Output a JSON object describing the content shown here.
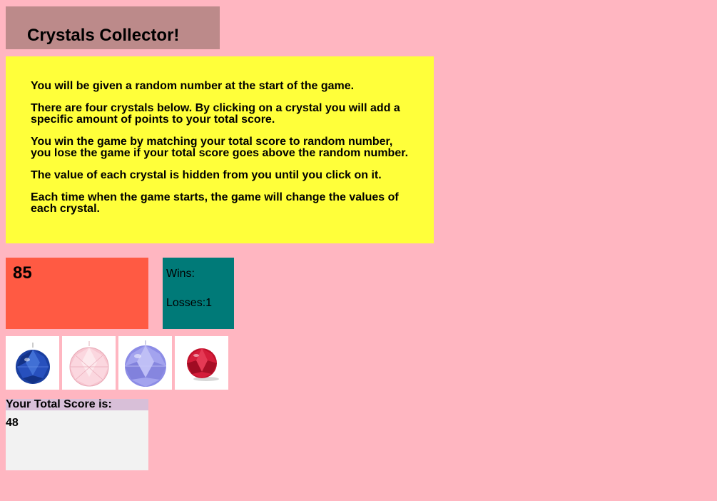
{
  "header": {
    "title": "Crystals Collector!"
  },
  "instructions": [
    "You will be given a random number at the start of the game.",
    "There are four crystals below. By clicking on a crystal you will add a specific amount of points to your total score.",
    "You win the game by matching your total score to random number, you lose the game if your total score goes above the random number.",
    "The value of each crystal is hidden from you until you click on it.",
    "Each time when the game starts, the game will change the values of each crystal."
  ],
  "game": {
    "random_number": "85",
    "wins_label": "Wins:",
    "wins_value": "",
    "losses_label": "Losses:",
    "losses_value": "1",
    "score_label": "Your Total Score is:",
    "score_value": "48"
  },
  "crystals": [
    {
      "name": "blue-crystal-icon",
      "color": "#1a3fa0"
    },
    {
      "name": "pink-crystal-icon",
      "color": "#f7c6d0"
    },
    {
      "name": "lavender-crystal-icon",
      "color": "#8c8ce6"
    },
    {
      "name": "red-crystal-icon",
      "color": "#c0102a"
    }
  ]
}
